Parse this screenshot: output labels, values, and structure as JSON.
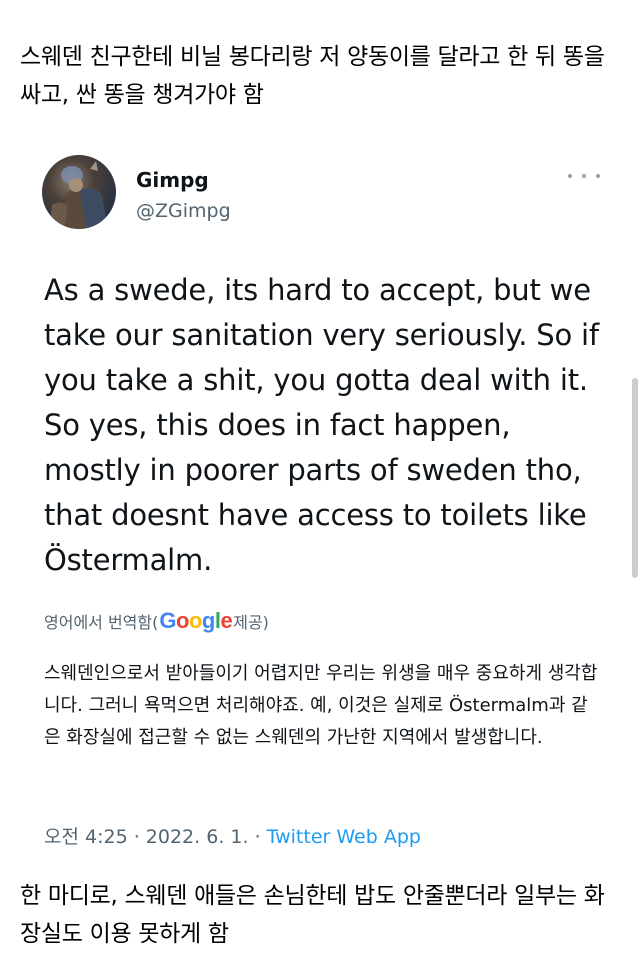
{
  "post": {
    "caption": "스웨덴 친구한테 비닐 봉다리랑 저 양동이를 달라고 한 뒤 똥을 싸고, 싼 똥을 챙겨가야 함",
    "footer": "한 마디로, 스웨덴 애들은 손님한테 밥도 안줄뿐더라 일부는 화장실도 이용 못하게 함"
  },
  "tweet": {
    "display_name": "Gimpg",
    "handle": "@ZGimpg",
    "more_icon": "more-horizontal-icon",
    "text": "As a swede, its hard to accept, but we take our sanitation very seriously. So if you take a shit, you gotta deal with it. So yes, this does in fact happen, mostly in poorer parts of sweden tho, that doesnt have access to toilets like Östermalm.",
    "translation": {
      "prefix": "영어에서 번역함(",
      "logo_letters": [
        "G",
        "o",
        "o",
        "g",
        "l",
        "e"
      ],
      "suffix": " 제공)",
      "text": "스웨덴인으로서 받아들이기 어렵지만 우리는 위생을 매우 중요하게 생각합니다. 그러니 욕먹으면 처리해야죠. 예, 이것은 실제로 Östermalm과 같은 화장실에 접근할 수 없는 스웨덴의 가난한 지역에서 발생합니다."
    },
    "time": "오전 4:25",
    "separator": " · ",
    "date": "2022. 6. 1.",
    "source": "Twitter Web App"
  },
  "colors": {
    "text_primary": "#0f1419",
    "text_secondary": "#536471",
    "link": "#1d9bf0"
  }
}
